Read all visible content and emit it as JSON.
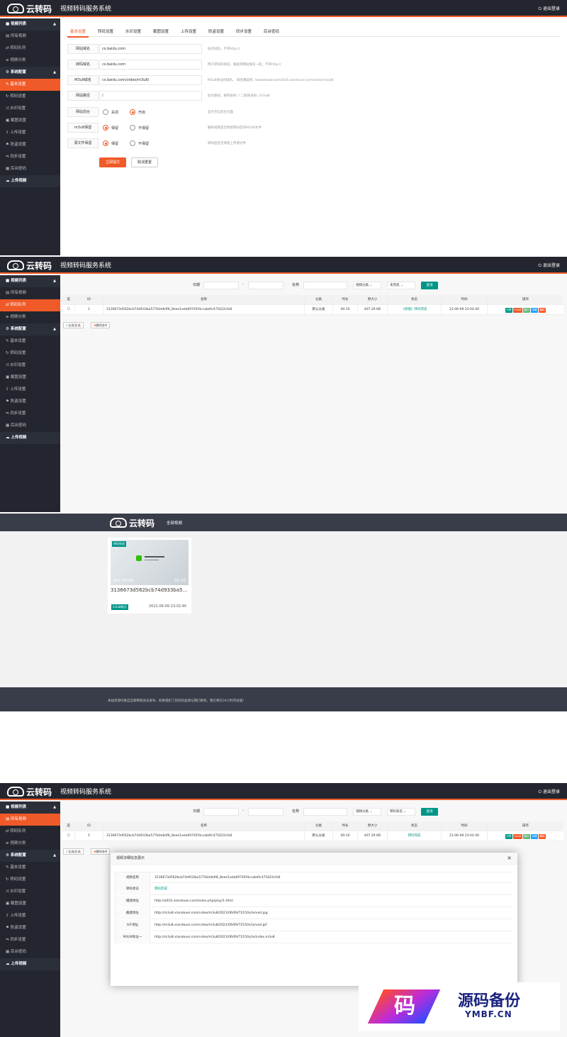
{
  "app": {
    "logo_text": "云转码",
    "title": "视频转码服务系统",
    "logout": "退出登录"
  },
  "sidebar": {
    "group_video": "视频列表",
    "items_video": [
      "所有视频",
      "转码队列",
      "视频分类"
    ],
    "group_config": "系统配置",
    "items_config": [
      "基本设置",
      "转码设置",
      "水印设置",
      "截图设置",
      "上传设置",
      "防盗设置",
      "同步设置",
      "后台密码"
    ],
    "upload": "上传视频"
  },
  "settings": {
    "tabs": [
      "基本设置",
      "转码设置",
      "水印设置",
      "截图设置",
      "上传设置",
      "防盗设置",
      "同步设置",
      "后台密码"
    ],
    "rows": [
      {
        "label": "网站域名",
        "value": "cs.baidu.com",
        "hint": "站点域名。不带http://"
      },
      {
        "label": "转码域名",
        "value": "cs.baidu.com",
        "hint": "用于转码的域名，横竖到网站域名一起，不带http://"
      },
      {
        "label": "M3u8域名",
        "value": "cs.baidu.com/video/m3u8/",
        "hint": "M3u8地址的域名。 域名横竖到: /www/wwwroot/a016.xiandouer.com/video/m3u8/"
      },
      {
        "label": "网站路径",
        "value": "/",
        "hint": "站点路径，根目录如: / 二级目录如: /m3u8/"
      }
    ],
    "row_frontend": {
      "label": "网站前台",
      "off": "关闭",
      "on": "开启",
      "hint": "是否开启前台页面"
    },
    "row_m3u8": {
      "label": "m3u8保留",
      "keep": "保留",
      "nokeep": "不保留",
      "hint": "删除视频是否保留转码后的M3U8文件"
    },
    "row_source": {
      "label": "源文件保留",
      "keep": "保留",
      "nokeep": "不保留",
      "hint": "转码后是否保留上传源文件"
    },
    "submit": "立即提交",
    "reset": "取消重置"
  },
  "queue": {
    "filter_date": "日期",
    "filter_dash": "-",
    "filter_name": "名称",
    "select_category": "视频分类",
    "select_status": "未完成",
    "select_status2": "转码状态",
    "search": "查询",
    "headers": [
      "选",
      "ID",
      "名称",
      "分类",
      "时长",
      "原大小",
      "状态",
      "时间",
      "操作"
    ],
    "row": {
      "id": "1",
      "name": "3136673d562bcb74d933ba577b0e6df8_8eee1ada69745f4ccabdfc471622cfa6",
      "category": "默认分类",
      "duration": "00:10",
      "size": "407.29 KB",
      "status": "《原图》转码完成",
      "status2": "转码完成",
      "time": "21-06-09 23:02:40"
    },
    "ops": [
      "分享",
      "m3u8",
      "图片",
      "详情",
      "删除"
    ],
    "select_all": "全选/反选",
    "delete_selected": "删除选中"
  },
  "gallery": {
    "nav": "全部视频",
    "badge": "转码完成",
    "size": "407.29 KB",
    "duration": "00:10",
    "title": "3136673d562bcb74d933ba5...",
    "format": "m3u8格式",
    "date": "2021-06-09 23:02:40",
    "footer": "本站资源均来自互联网或会员发布，如果侵犯了您的权益请与我们联系，我们将在24小时内处理!"
  },
  "modal": {
    "title": "视频详细信息展示",
    "rows": [
      {
        "label": "视频名称",
        "value": "3136673d562bcb74d933ba577b0e6df8_8eee1ada69745f4ccabdfc471622cfa6"
      },
      {
        "label": "转码状态",
        "value": "转码完成"
      },
      {
        "label": "播放地址",
        "value": "http://a016.xiandouer.com/index.php/play/1.html"
      },
      {
        "label": "截图地址",
        "value": "http://m3u8.xiandouer.com/video/m3u8/2021/06/09/72150a1e/vod.jpg"
      },
      {
        "label": "GIF地址",
        "value": "http://m3u8.xiandouer.com/video/m3u8/2021/06/09/72150a1e/vod.gif"
      },
      {
        "label": "M3U8地址一",
        "value": "http://m3u8.xiandouer.com/video/m3u8/2021/06/09/72150a1e/index.m3u8"
      }
    ]
  },
  "watermark": {
    "text": "源码备份",
    "sub": "YMBF.CN",
    "glyph": "码"
  },
  "colors": {
    "accent": "#f05a28",
    "dark": "#23262e",
    "green": "#009688"
  }
}
